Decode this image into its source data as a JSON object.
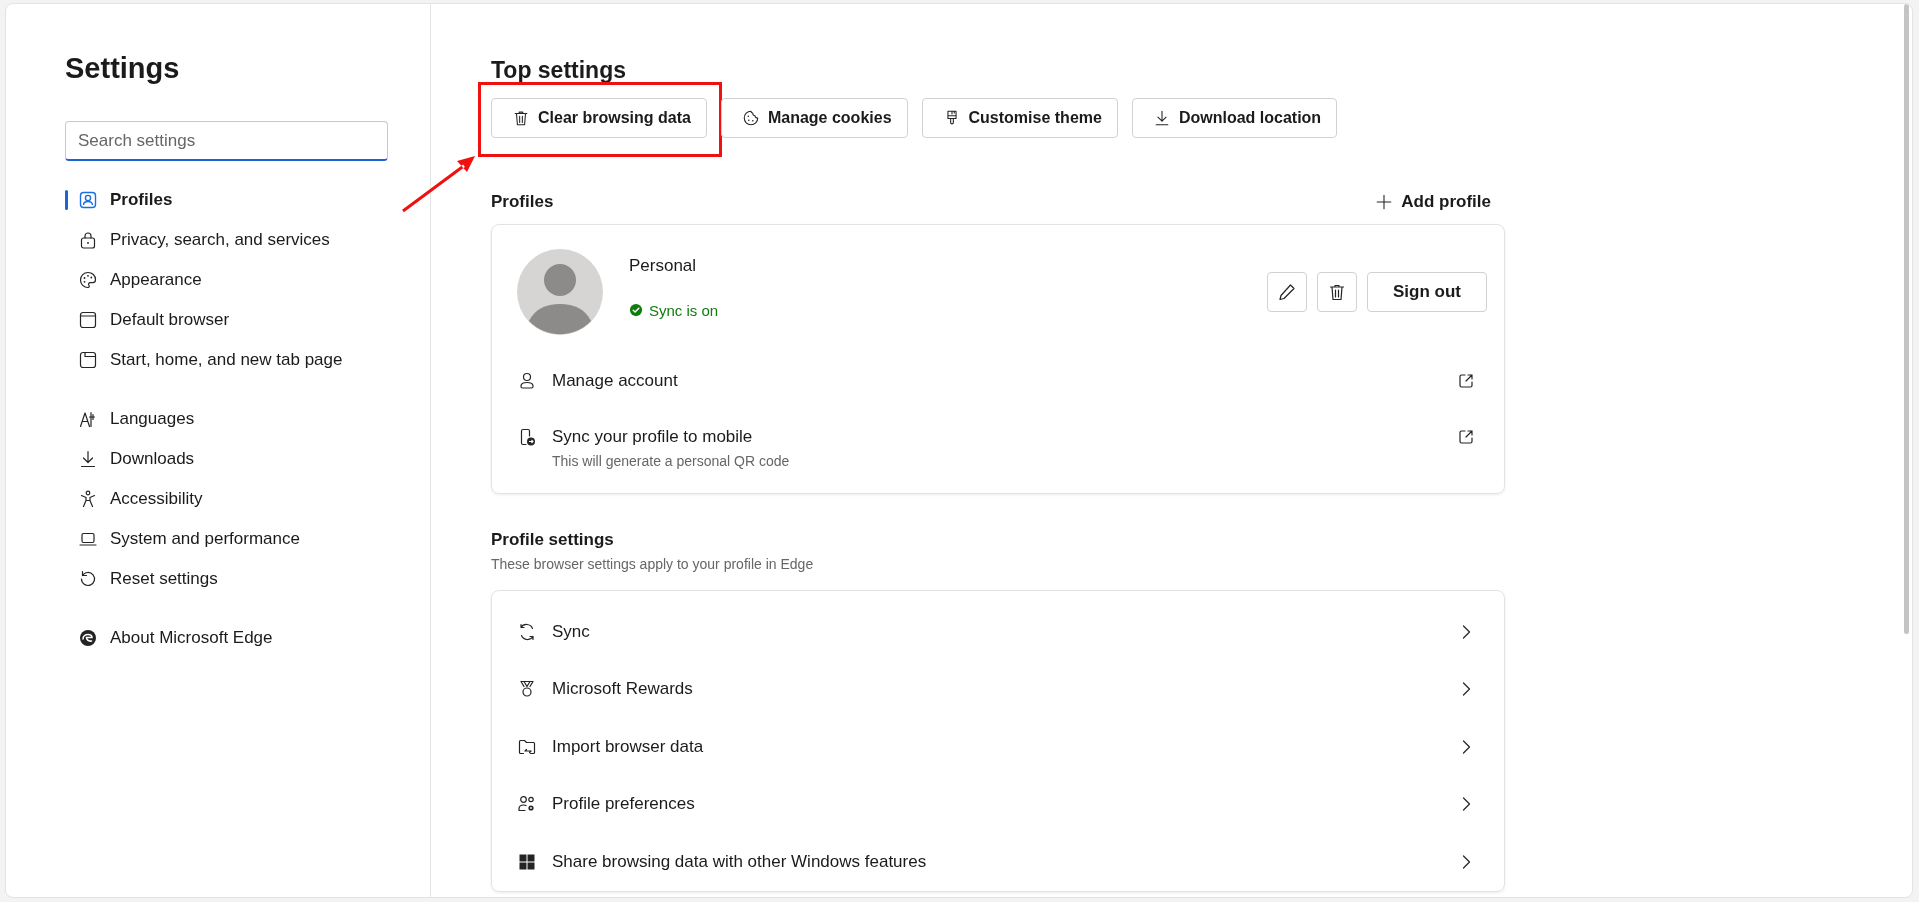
{
  "sidebar": {
    "title": "Settings",
    "search": {
      "placeholder": "Search settings"
    },
    "sections": [
      {
        "items": [
          {
            "label": "Profiles",
            "selected": true
          },
          {
            "label": "Privacy, search, and services",
            "selected": false
          },
          {
            "label": "Appearance",
            "selected": false
          },
          {
            "label": "Default browser",
            "selected": false
          },
          {
            "label": "Start, home, and new tab page",
            "selected": false
          }
        ]
      },
      {
        "items": [
          {
            "label": "Languages",
            "selected": false
          },
          {
            "label": "Downloads",
            "selected": false
          },
          {
            "label": "Accessibility",
            "selected": false
          },
          {
            "label": "System and performance",
            "selected": false
          },
          {
            "label": "Reset settings",
            "selected": false
          }
        ]
      },
      {
        "items": [
          {
            "label": "About Microsoft Edge",
            "selected": false
          }
        ]
      }
    ]
  },
  "top_settings": {
    "title": "Top settings",
    "buttons": [
      {
        "label": "Clear browsing data",
        "highlighted": true
      },
      {
        "label": "Manage cookies",
        "highlighted": false
      },
      {
        "label": "Customise theme",
        "highlighted": false
      },
      {
        "label": "Download location",
        "highlighted": false
      }
    ]
  },
  "profiles": {
    "title": "Profiles",
    "add_button": "Add profile",
    "profile": {
      "name": "Personal",
      "sync_status": "Sync is on",
      "sign_out": "Sign out"
    },
    "rows": [
      {
        "label": "Manage account"
      },
      {
        "label": "Sync your profile to mobile",
        "description": "This will generate a personal QR code"
      }
    ]
  },
  "profile_settings": {
    "title": "Profile settings",
    "subtitle": "These browser settings apply to your profile in Edge",
    "rows": [
      {
        "label": "Sync"
      },
      {
        "label": "Microsoft Rewards"
      },
      {
        "label": "Import browser data"
      },
      {
        "label": "Profile preferences"
      },
      {
        "label": "Share browsing data with other Windows features"
      }
    ]
  }
}
